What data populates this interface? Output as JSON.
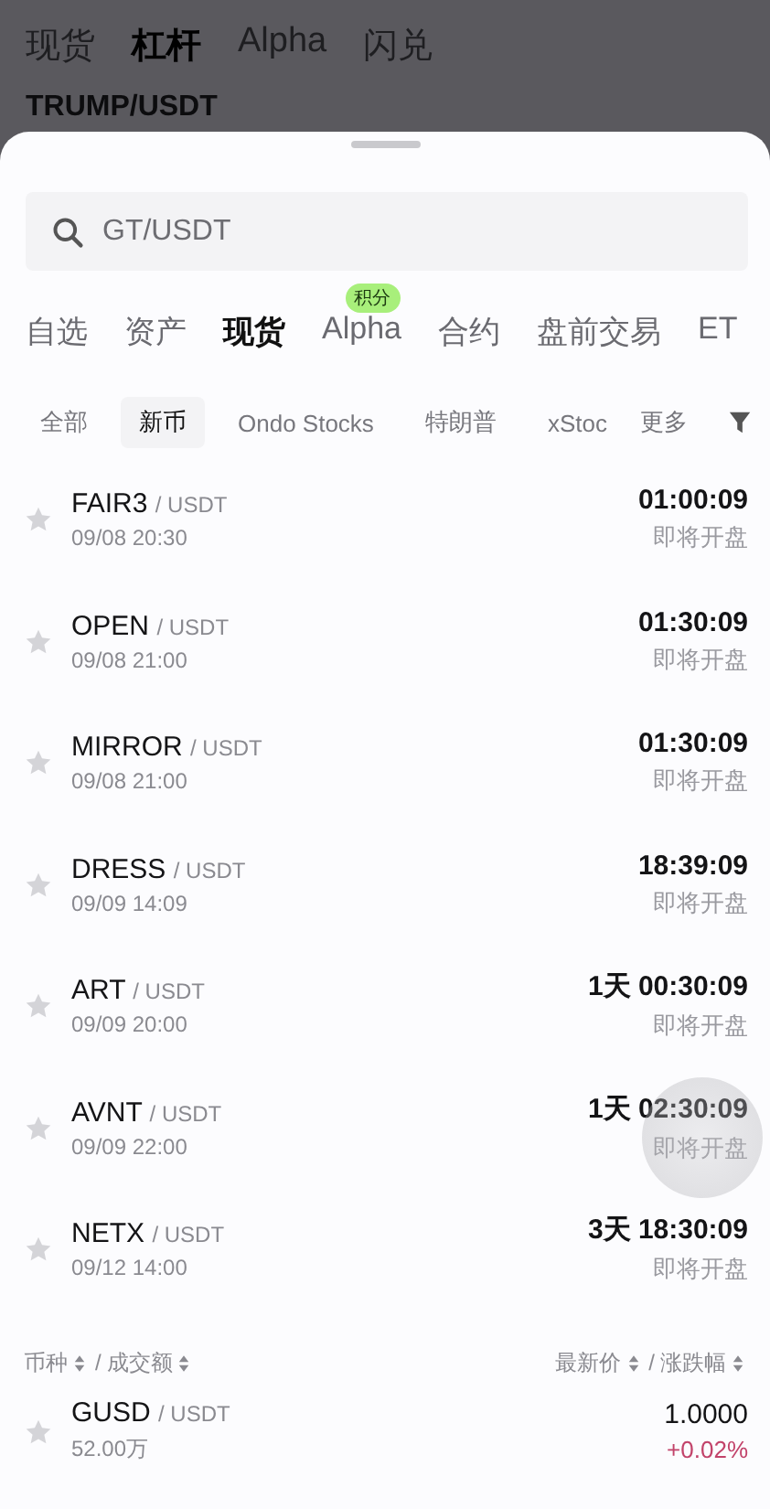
{
  "backdrop": {
    "tabs": [
      {
        "label": "现货",
        "selected": false
      },
      {
        "label": "杠杆",
        "selected": true
      },
      {
        "label": "Alpha",
        "selected": false
      },
      {
        "label": "闪兑",
        "selected": false
      }
    ],
    "pair": "TRUMP/USDT"
  },
  "search": {
    "placeholder": "GT/USDT"
  },
  "tabs": [
    {
      "label": "自选",
      "selected": false
    },
    {
      "label": "资产",
      "selected": false
    },
    {
      "label": "现货",
      "selected": true
    },
    {
      "label": "Alpha",
      "selected": false,
      "badge": "积分"
    },
    {
      "label": "合约",
      "selected": false
    },
    {
      "label": "盘前交易",
      "selected": false
    },
    {
      "label": "ET",
      "selected": false
    }
  ],
  "filters": [
    {
      "label": "全部",
      "selected": false
    },
    {
      "label": "新币",
      "selected": true
    },
    {
      "label": "Ondo Stocks",
      "selected": false
    },
    {
      "label": "特朗普",
      "selected": false
    },
    {
      "label": "xStoc",
      "selected": false
    }
  ],
  "filters_more": "更多",
  "new_listings": [
    {
      "base": "FAIR3",
      "quote": "/ USDT",
      "sub": "09/08 20:30",
      "countdown": "01:00:09",
      "status": "即将开盘",
      "starred": false
    },
    {
      "base": "OPEN",
      "quote": "/ USDT",
      "sub": "09/08 21:00",
      "countdown": "01:30:09",
      "status": "即将开盘",
      "starred": false
    },
    {
      "base": "MIRROR",
      "quote": "/ USDT",
      "sub": "09/08 21:00",
      "countdown": "01:30:09",
      "status": "即将开盘",
      "starred": false
    },
    {
      "base": "DRESS",
      "quote": "/ USDT",
      "sub": "09/09 14:09",
      "countdown": "18:39:09",
      "status": "即将开盘",
      "starred": false
    },
    {
      "base": "ART",
      "quote": "/ USDT",
      "sub": "09/09 20:00",
      "countdown": "1天 00:30:09",
      "status": "即将开盘",
      "starred": false
    },
    {
      "base": "AVNT",
      "quote": "/ USDT",
      "sub": "09/09 22:00",
      "countdown": "1天 02:30:09",
      "status": "即将开盘",
      "starred": false
    },
    {
      "base": "NETX",
      "quote": "/ USDT",
      "sub": "09/12 14:00",
      "countdown": "3天 18:30:09",
      "status": "即将开盘",
      "starred": false
    }
  ],
  "market_header": {
    "left": [
      "币种",
      "成交额"
    ],
    "right": [
      "最新价",
      "涨跌幅"
    ],
    "separator": "/"
  },
  "market": [
    {
      "base": "GUSD",
      "quote": "/ USDT",
      "sub": "52.00万",
      "price": "1.0000",
      "change": "+0.02%",
      "rising": true,
      "starred": false
    }
  ]
}
